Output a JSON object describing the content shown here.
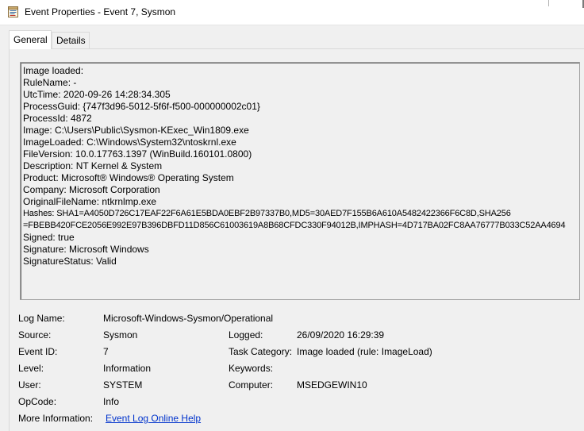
{
  "window": {
    "title": "Event Properties - Event 7, Sysmon",
    "icon": "event-viewer-icon"
  },
  "tabs": [
    {
      "label": "General",
      "active": true
    },
    {
      "label": "Details",
      "active": false
    }
  ],
  "description_lines": [
    "Image loaded:",
    "RuleName: -",
    "UtcTime: 2020-09-26 14:28:34.305",
    "ProcessGuid: {747f3d96-5012-5f6f-f500-000000002c01}",
    "ProcessId: 4872",
    "Image: C:\\Users\\Public\\Sysmon-KExec_Win1809.exe",
    "ImageLoaded: C:\\Windows\\System32\\ntoskrnl.exe",
    "FileVersion: 10.0.17763.1397 (WinBuild.160101.0800)",
    "Description: NT Kernel & System",
    "Product: Microsoft® Windows® Operating System",
    "Company: Microsoft Corporation",
    "OriginalFileName: ntkrnlmp.exe",
    "Hashes: SHA1=A4050D726C17EAF22F6A61E5BDA0EBF2B97337B0,MD5=30AED7F155B6A610A5482422366F6C8D,SHA256",
    "=FBEBB420FCE2056E992E97B396DBFD11D856C61003619A8B68CFDC330F94012B,IMPHASH=4D717BA02FC8AA76777B033C52AA4694",
    "Signed: true",
    "Signature: Microsoft Windows",
    "SignatureStatus: Valid"
  ],
  "properties": {
    "log_name_label": "Log Name:",
    "log_name_value": "Microsoft-Windows-Sysmon/Operational",
    "source_label": "Source:",
    "source_value": "Sysmon",
    "logged_label": "Logged:",
    "logged_value": "26/09/2020 16:29:39",
    "event_id_label": "Event ID:",
    "event_id_value": "7",
    "task_category_label": "Task Category:",
    "task_category_value": "Image loaded (rule: ImageLoad)",
    "level_label": "Level:",
    "level_value": "Information",
    "keywords_label": "Keywords:",
    "keywords_value": "",
    "user_label": "User:",
    "user_value": "SYSTEM",
    "computer_label": "Computer:",
    "computer_value": "MSEDGEWIN10",
    "opcode_label": "OpCode:",
    "opcode_value": "Info",
    "more_info_label": "More Information:",
    "more_info_link": "Event Log Online Help"
  },
  "colors": {
    "window_bg": "#f0f0f0",
    "link": "#0033cc",
    "border": "#a0a0a0"
  }
}
